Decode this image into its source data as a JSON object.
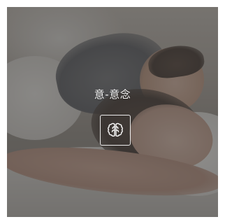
{
  "card": {
    "title": "意-意念",
    "icon": "brain-icon",
    "overlay_color": "#3c3c3c"
  }
}
